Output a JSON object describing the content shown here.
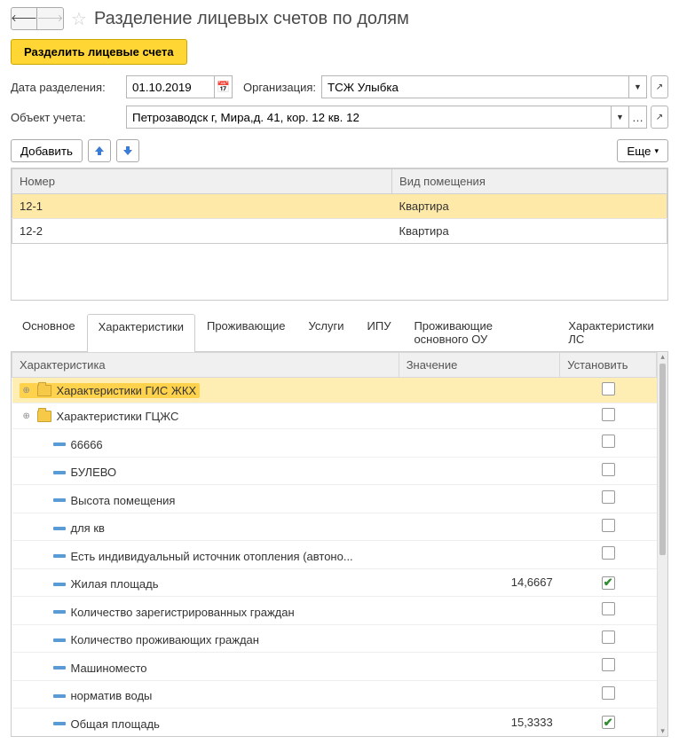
{
  "header": {
    "title": "Разделение лицевых счетов по долям"
  },
  "actions": {
    "split": "Разделить лицевые счета",
    "add": "Добавить",
    "more": "Еще"
  },
  "form": {
    "date_label": "Дата разделения:",
    "date_value": "01.10.2019",
    "org_label": "Организация:",
    "org_value": "ТСЖ Улыбка",
    "obj_label": "Объект учета:",
    "obj_value": "Петрозаводск г, Мира,д. 41, кор. 12 кв. 12"
  },
  "accounts": {
    "columns": {
      "number": "Номер",
      "type": "Вид помещения"
    },
    "rows": [
      {
        "number": "12-1",
        "type": "Квартира",
        "selected": true
      },
      {
        "number": "12-2",
        "type": "Квартира",
        "selected": false
      }
    ]
  },
  "tabs": [
    {
      "label": "Основное",
      "active": false
    },
    {
      "label": "Характеристики",
      "active": true
    },
    {
      "label": "Проживающие",
      "active": false
    },
    {
      "label": "Услуги",
      "active": false
    },
    {
      "label": "ИПУ",
      "active": false
    },
    {
      "label": "Проживающие основного ОУ",
      "active": false
    },
    {
      "label": "Характеристики ЛС",
      "active": false
    }
  ],
  "characteristics": {
    "columns": {
      "name": "Характеристика",
      "value": "Значение",
      "set": "Установить"
    },
    "rows": [
      {
        "kind": "group",
        "name": "Характеристики ГИС ЖКХ",
        "value": "",
        "checked": false,
        "selected": true,
        "indent": 0
      },
      {
        "kind": "group",
        "name": "Характеристики ГЦЖС",
        "value": "",
        "checked": false,
        "selected": false,
        "indent": 0
      },
      {
        "kind": "item",
        "name": "66666",
        "value": "",
        "checked": false,
        "indent": 1
      },
      {
        "kind": "item",
        "name": "БУЛЕВО",
        "value": "",
        "checked": false,
        "indent": 1
      },
      {
        "kind": "item",
        "name": "Высота помещения",
        "value": "",
        "checked": false,
        "indent": 1
      },
      {
        "kind": "item",
        "name": "для кв",
        "value": "",
        "checked": false,
        "indent": 1
      },
      {
        "kind": "item",
        "name": "Есть индивидуальный источник отопления (автоно...",
        "value": "",
        "checked": false,
        "indent": 1
      },
      {
        "kind": "item",
        "name": "Жилая площадь",
        "value": "14,6667",
        "checked": true,
        "indent": 1
      },
      {
        "kind": "item",
        "name": "Количество зарегистрированных граждан",
        "value": "",
        "checked": false,
        "indent": 1
      },
      {
        "kind": "item",
        "name": "Количество проживающих граждан",
        "value": "",
        "checked": false,
        "indent": 1
      },
      {
        "kind": "item",
        "name": "Машиноместо",
        "value": "",
        "checked": false,
        "indent": 1
      },
      {
        "kind": "item",
        "name": "норматив воды",
        "value": "",
        "checked": false,
        "indent": 1
      },
      {
        "kind": "item",
        "name": "Общая площадь",
        "value": "15,3333",
        "checked": true,
        "indent": 1
      }
    ]
  }
}
